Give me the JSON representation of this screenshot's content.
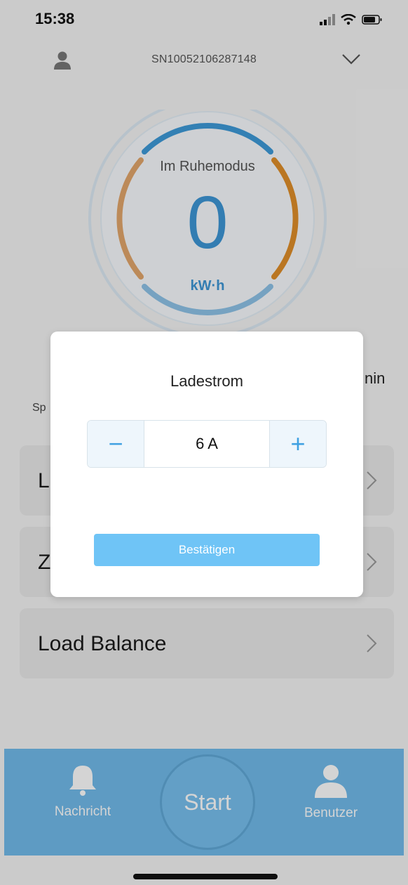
{
  "status_bar": {
    "time": "15:38"
  },
  "header": {
    "serial": "SN10052106287148"
  },
  "gauge": {
    "status": "Im Ruhemodus",
    "value": "0",
    "unit": "kW·h"
  },
  "behind": {
    "partial_right": "nin",
    "partial_left": "Sp"
  },
  "cards": [
    {
      "label": "L"
    },
    {
      "label": "Z"
    },
    {
      "label": "Load Balance"
    }
  ],
  "nav": {
    "message": "Nachricht",
    "start": "Start",
    "user": "Benutzer"
  },
  "modal": {
    "title": "Ladestrom",
    "value": "6 A",
    "minus": "−",
    "plus": "+",
    "confirm": "Bestätigen"
  }
}
